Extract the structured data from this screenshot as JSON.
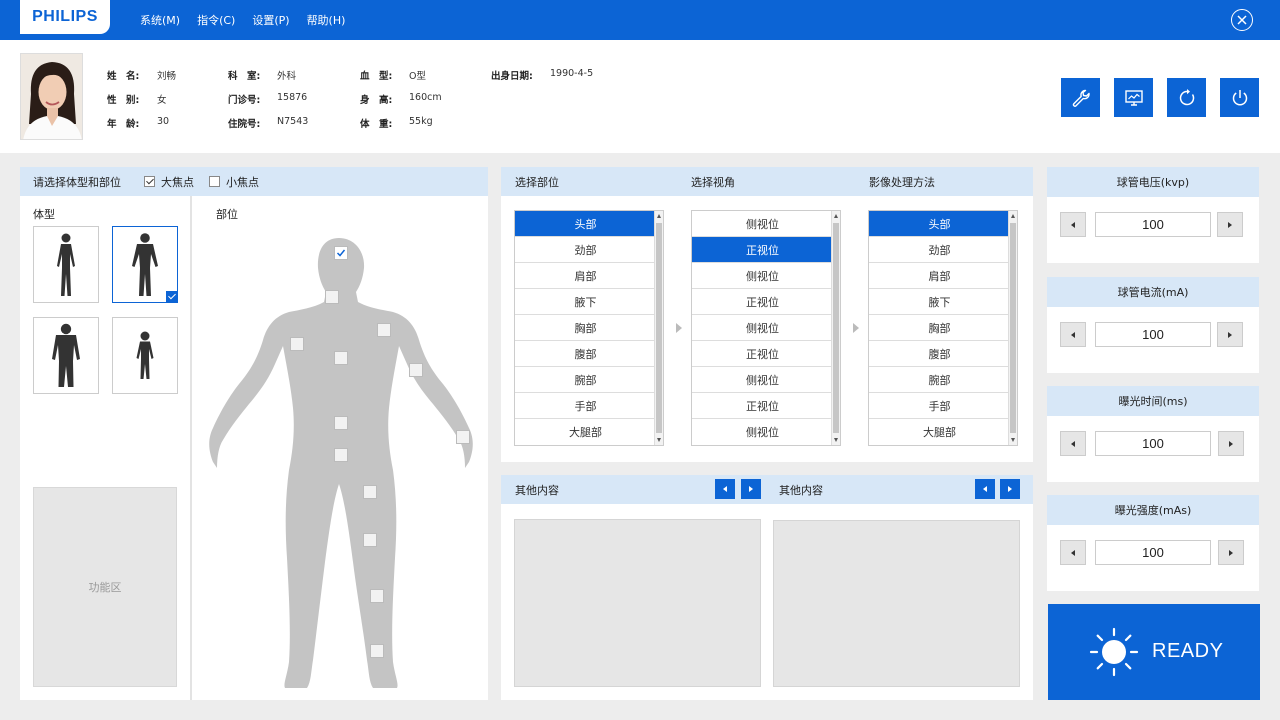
{
  "app": {
    "logo": "PHILIPS"
  },
  "menu": [
    "系统(M)",
    "指令(C)",
    "设置(P)",
    "帮助(H)"
  ],
  "patient": {
    "name_label": "姓　名:",
    "name": "刘畅",
    "gender_label": "性　别:",
    "gender": "女",
    "age_label": "年　龄:",
    "age": "30",
    "dept_label": "科　室:",
    "dept": "外科",
    "clinic_label": "门诊号:",
    "clinic": "15876",
    "inpatient_label": "住院号:",
    "inpatient": "N7543",
    "blood_label": "血　型:",
    "blood": "O型",
    "height_label": "身　高:",
    "height": "160cm",
    "weight_label": "体　重:",
    "weight": "55kg",
    "dob_label": "出身日期:",
    "dob": "1990-4-5"
  },
  "left_panel": {
    "header": "请选择体型和部位",
    "large_focus": "大焦点",
    "small_focus": "小焦点",
    "body_type_label": "体型",
    "part_label": "部位",
    "function_area": "功能区"
  },
  "center": {
    "select_part": "选择部位",
    "select_view": "选择视角",
    "image_method": "影像处理方法",
    "parts": [
      "头部",
      "劲部",
      "肩部",
      "腋下",
      "胸部",
      "腹部",
      "腕部",
      "手部",
      "大腿部"
    ],
    "views": [
      "侧视位",
      "正视位",
      "侧视位",
      "正视位",
      "侧视位",
      "正视位",
      "侧视位",
      "正视位",
      "侧视位"
    ],
    "methods": [
      "头部",
      "劲部",
      "肩部",
      "腋下",
      "胸部",
      "腹部",
      "腕部",
      "手部",
      "大腿部"
    ],
    "other_left": "其他内容",
    "other_right": "其他内容"
  },
  "params": [
    {
      "label": "球管电压(kvp)",
      "value": "100"
    },
    {
      "label": "球管电流(mA)",
      "value": "100"
    },
    {
      "label": "曝光时间(ms)",
      "value": "100"
    },
    {
      "label": "曝光强度(mAs)",
      "value": "100"
    }
  ],
  "ready": "READY",
  "colors": {
    "primary": "#0c64d5",
    "header_bg": "#d7e7f7",
    "page_bg": "#ededed"
  }
}
